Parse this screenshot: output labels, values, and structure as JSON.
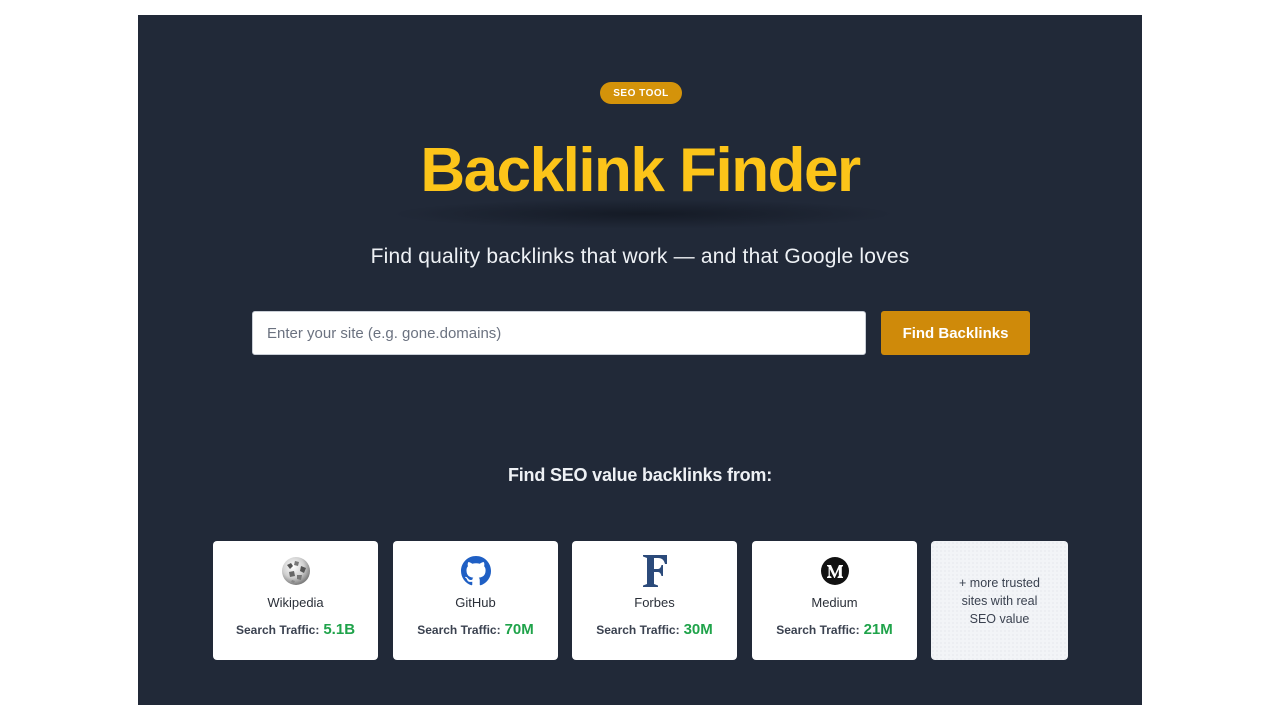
{
  "hero": {
    "badge": "SEO TOOL",
    "title": "Backlink Finder",
    "subtitle": "Find quality backlinks that work — and that Google loves"
  },
  "search": {
    "placeholder": "Enter your site (e.g. gone.domains)",
    "value": "",
    "button_label": "Find Backlinks"
  },
  "sources": {
    "heading": "Find SEO value backlinks from:",
    "traffic_label": "Search Traffic:",
    "items": [
      {
        "name": "Wikipedia",
        "traffic": "5.1B",
        "icon": "wikipedia-globe-icon"
      },
      {
        "name": "GitHub",
        "traffic": "70M",
        "icon": "github-octocat-icon"
      },
      {
        "name": "Forbes",
        "traffic": "30M",
        "icon": "forbes-f-icon"
      },
      {
        "name": "Medium",
        "traffic": "21M",
        "icon": "medium-m-icon"
      }
    ],
    "more_text": "+ more trusted sites with real SEO value"
  },
  "colors": {
    "panel_bg": "#212938",
    "title": "#fcc419",
    "accent": "#cf8a0a",
    "traffic_value": "#1fa34a",
    "github_blue": "#1f5fc4"
  }
}
